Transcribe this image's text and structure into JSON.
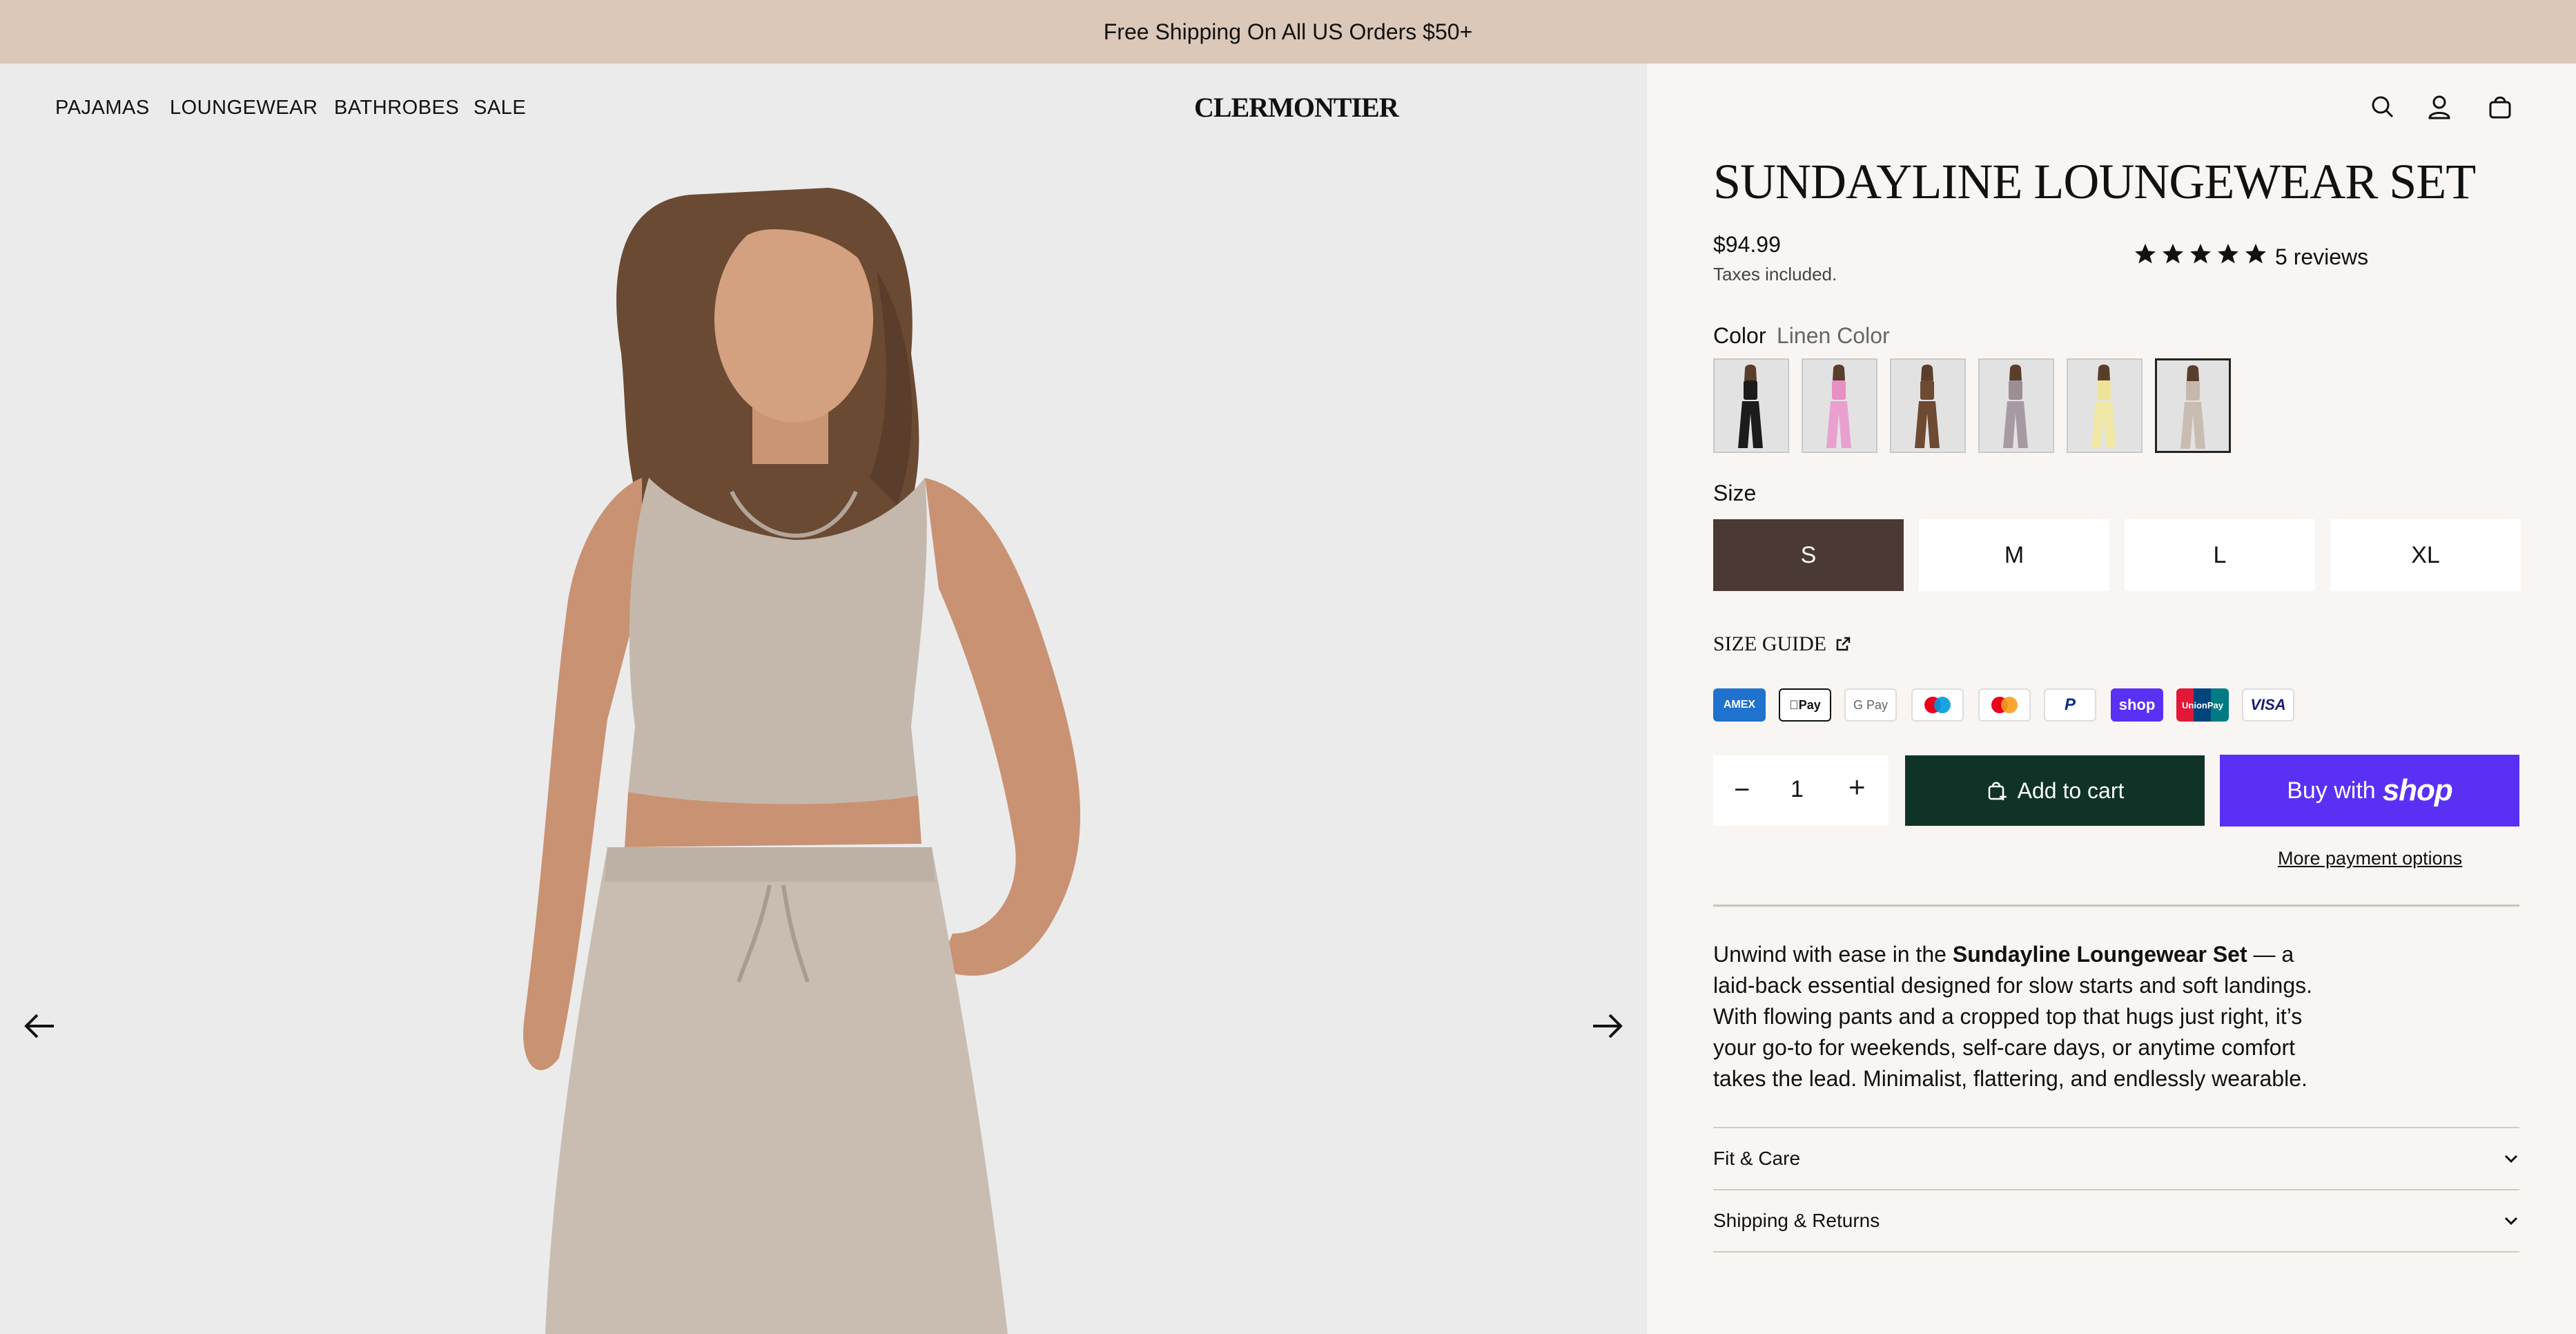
{
  "announcement": "Free Shipping On All US Orders $50+",
  "nav": {
    "items": [
      "PAJAMAS",
      "LOUNGEWEAR",
      "BATHROBES",
      "SALE"
    ]
  },
  "brand": {
    "logo": "CLERMONTIER"
  },
  "header_icons": [
    "search-icon",
    "account-icon",
    "cart-bag-icon"
  ],
  "product": {
    "title": "SUNDAYLINE LOUNGEWEAR SET",
    "price": "$94.99",
    "taxes": "Taxes included.",
    "rating": 5,
    "reviews": "5 reviews",
    "color_label": "Color",
    "color_value": "Linen Color",
    "swatches": [
      {
        "name": "black",
        "top": "#1c1c1c",
        "pants": "#1c1c1c"
      },
      {
        "name": "pink",
        "top": "#e88fc6",
        "pants": "#e9a0cf"
      },
      {
        "name": "brown",
        "top": "#6e4a32",
        "pants": "#6e4a32"
      },
      {
        "name": "mauve",
        "top": "#9b8e94",
        "pants": "#a79aa3"
      },
      {
        "name": "yellow",
        "top": "#efe39a",
        "pants": "#f1e8a6"
      },
      {
        "name": "linen",
        "top": "#c4b8ad",
        "pants": "#c9bdb2"
      }
    ],
    "selected_swatch": 5,
    "size_label": "Size",
    "sizes": [
      "S",
      "M",
      "L",
      "XL"
    ],
    "selected_size": "S",
    "size_guide": "SIZE GUIDE",
    "payment_methods": [
      "AMEX",
      "Pay",
      "G Pay",
      "maestro",
      "mastercard",
      "PayPal",
      "shop",
      "UnionPay",
      "VISA"
    ],
    "quantity": "1",
    "add_to_cart": "Add to cart",
    "buy_with": "Buy with",
    "buy_brand": "shop",
    "more_payment": "More payment options",
    "description": {
      "intro": "Unwind with ease in the ",
      "bold": "Sundayline Loungewear Set",
      "rest": " — a laid-back essential designed for slow starts and soft landings. With flowing pants and a cropped top that hugs just right, it’s your go-to for weekends, self-care days, or anytime comfort takes the lead. Minimalist, flattering, and endlessly wearable."
    },
    "accordions": [
      "Fit & Care",
      "Shipping & Returns"
    ]
  },
  "colors": {
    "accent_dark": "#0f3326",
    "shop_purple": "#5a31f4",
    "size_selected": "#4a3a33",
    "announce_bg": "#dcc8b8"
  }
}
